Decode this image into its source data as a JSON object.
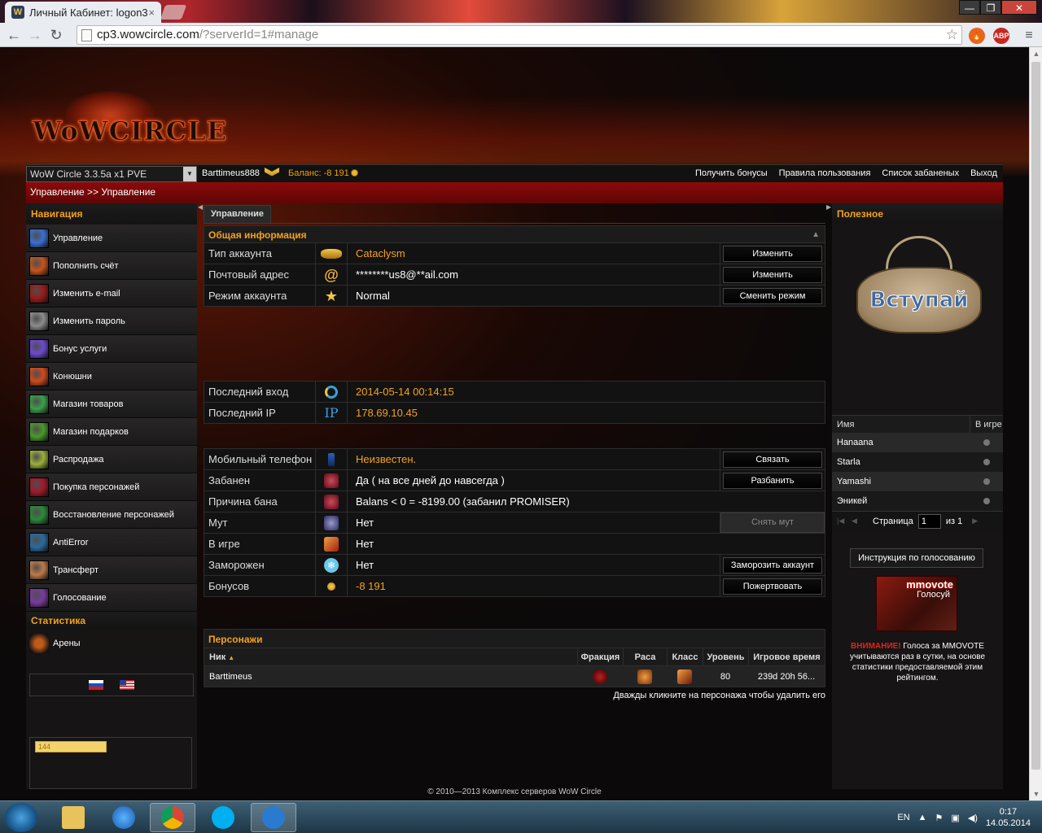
{
  "browser": {
    "tab_title": "Личный Кабинет: logon3",
    "tab_favicon": "W",
    "url_host": "cp3.wowcircle.com",
    "url_path": "/?serverId=1#manage",
    "ext_abp": "ABP"
  },
  "header": {
    "logo": "WoWCIRCLE",
    "realm": "WoW Circle 3.3.5a x1 PVE",
    "username": "Barttimeus888",
    "balance_label": "Баланс:",
    "balance_value": "-8 191",
    "links": [
      "Получить бонусы",
      "Правила пользования",
      "Список забаненых",
      "Выход"
    ]
  },
  "breadcrumb": "Управление >> Управление",
  "nav": {
    "title": "Навигация",
    "items": [
      {
        "label": "Управление",
        "icon": "manage-icon",
        "color": "#3a6fd0"
      },
      {
        "label": "Пополнить счёт",
        "icon": "deposit-icon",
        "color": "#c9531c"
      },
      {
        "label": "Изменить e-mail",
        "icon": "email-icon",
        "color": "#9b1a1a"
      },
      {
        "label": "Изменить пароль",
        "icon": "password-icon",
        "color": "#8c8c8c"
      },
      {
        "label": "Бонус услуги",
        "icon": "bonus-icon",
        "color": "#6f4ad0"
      },
      {
        "label": "Конюшни",
        "icon": "stables-icon",
        "color": "#d04a1c"
      },
      {
        "label": "Магазин товаров",
        "icon": "shop-icon",
        "color": "#3aa04a"
      },
      {
        "label": "Магазин подарков",
        "icon": "gift-icon",
        "color": "#4a9a2a"
      },
      {
        "label": "Распродажа",
        "icon": "sale-icon",
        "color": "#9ab03a"
      },
      {
        "label": "Покупка персонажей",
        "icon": "buy-character-icon",
        "color": "#a01a2a"
      },
      {
        "label": "Восстановление персонажей",
        "icon": "restore-character-icon",
        "color": "#2a8a3a"
      },
      {
        "label": "AntiError",
        "icon": "antierror-icon",
        "color": "#2a6aa0"
      },
      {
        "label": "Трансферт",
        "icon": "transfer-icon",
        "color": "#c07a4a"
      },
      {
        "label": "Голосование",
        "icon": "vote-icon",
        "color": "#7a3aa0"
      }
    ],
    "stats_title": "Статистика",
    "stats_items": [
      {
        "label": "Арены",
        "icon": "arena-icon",
        "color": "#c05a1a"
      }
    ],
    "counter": "144"
  },
  "main": {
    "tab": "Управление",
    "general_title": "Общая информация",
    "rows1": [
      {
        "label": "Тип аккаунта",
        "value": "Cataclysm",
        "gold": true,
        "icon": "cataclysm-icon",
        "action": "Изменить"
      },
      {
        "label": "Почтовый адрес",
        "value": "********us8@**ail.com",
        "gold": false,
        "icon": "at-icon",
        "action": "Изменить"
      },
      {
        "label": "Режим аккаунта",
        "value": "Normal",
        "gold": false,
        "icon": "star-icon",
        "action": "Сменить режим"
      }
    ],
    "rows2": [
      {
        "label": "Последний вход",
        "value": "2014-05-14 00:14:15",
        "gold": true,
        "icon": "refresh-icon"
      },
      {
        "label": "Последний IP",
        "value": "178.69.10.45",
        "gold": true,
        "icon": "ip-icon"
      }
    ],
    "rows3": [
      {
        "label": "Мобильный телефон",
        "value": "Неизвестен.",
        "gold": true,
        "icon": "phone-icon",
        "action": "Связать"
      },
      {
        "label": "Забанен",
        "value": "Да ( на все дней до навсегда )",
        "gold": false,
        "icon": "ban-icon",
        "action": "Разбанить"
      },
      {
        "label": "Причина бана",
        "value": "Balans < 0 = -8199.00 (забанил PROMISER)",
        "gold": false,
        "icon": "ban-reason-icon"
      },
      {
        "label": "Мут",
        "value": "Нет",
        "gold": false,
        "icon": "mute-icon",
        "action": "Снять мут",
        "disabled": true
      },
      {
        "label": "В игре",
        "value": "Нет",
        "gold": false,
        "icon": "ingame-icon"
      },
      {
        "label": "Заморожен",
        "value": "Нет",
        "gold": false,
        "icon": "snowflake-icon",
        "action": "Заморозить аккаунт"
      },
      {
        "label": "Бонусов",
        "value": "-8 191",
        "gold": true,
        "icon": "coin-icon",
        "action": "Пожертвовать"
      }
    ],
    "chars_title": "Персонажи",
    "chars_cols": [
      "Ник",
      "Фракция",
      "Раса",
      "Класс",
      "Уровень",
      "Игровое время"
    ],
    "chars": [
      {
        "name": "Barttimeus",
        "level": "80",
        "time": "239d 20h 56..."
      }
    ],
    "chars_hint": "Дважды кликните на персонажа чтобы удалить его"
  },
  "right": {
    "title": "Полезное",
    "vk_text": "Вступай",
    "online_cols": [
      "Имя",
      "В игре"
    ],
    "online": [
      "Hanaana",
      "Starla",
      "Yamashi",
      "Эникей"
    ],
    "page_label": "Страница",
    "page_value": "1",
    "page_of": "из 1",
    "vote_button": "Инструкция по голосованию",
    "mmo_title": "mmovote",
    "mmo_sub": "Голосуй",
    "warn_red": "ВНИМАНИЕ!",
    "warn_text": "Голоса за MMOVOTE учитываются раз в сутки, на основе статистики предоставляемой этим рейтингом."
  },
  "footer": "© 2010—2013 Комплекс серверов WoW Circle",
  "taskbar": {
    "lang": "EN",
    "time": "0:17",
    "date": "14.05.2014"
  }
}
